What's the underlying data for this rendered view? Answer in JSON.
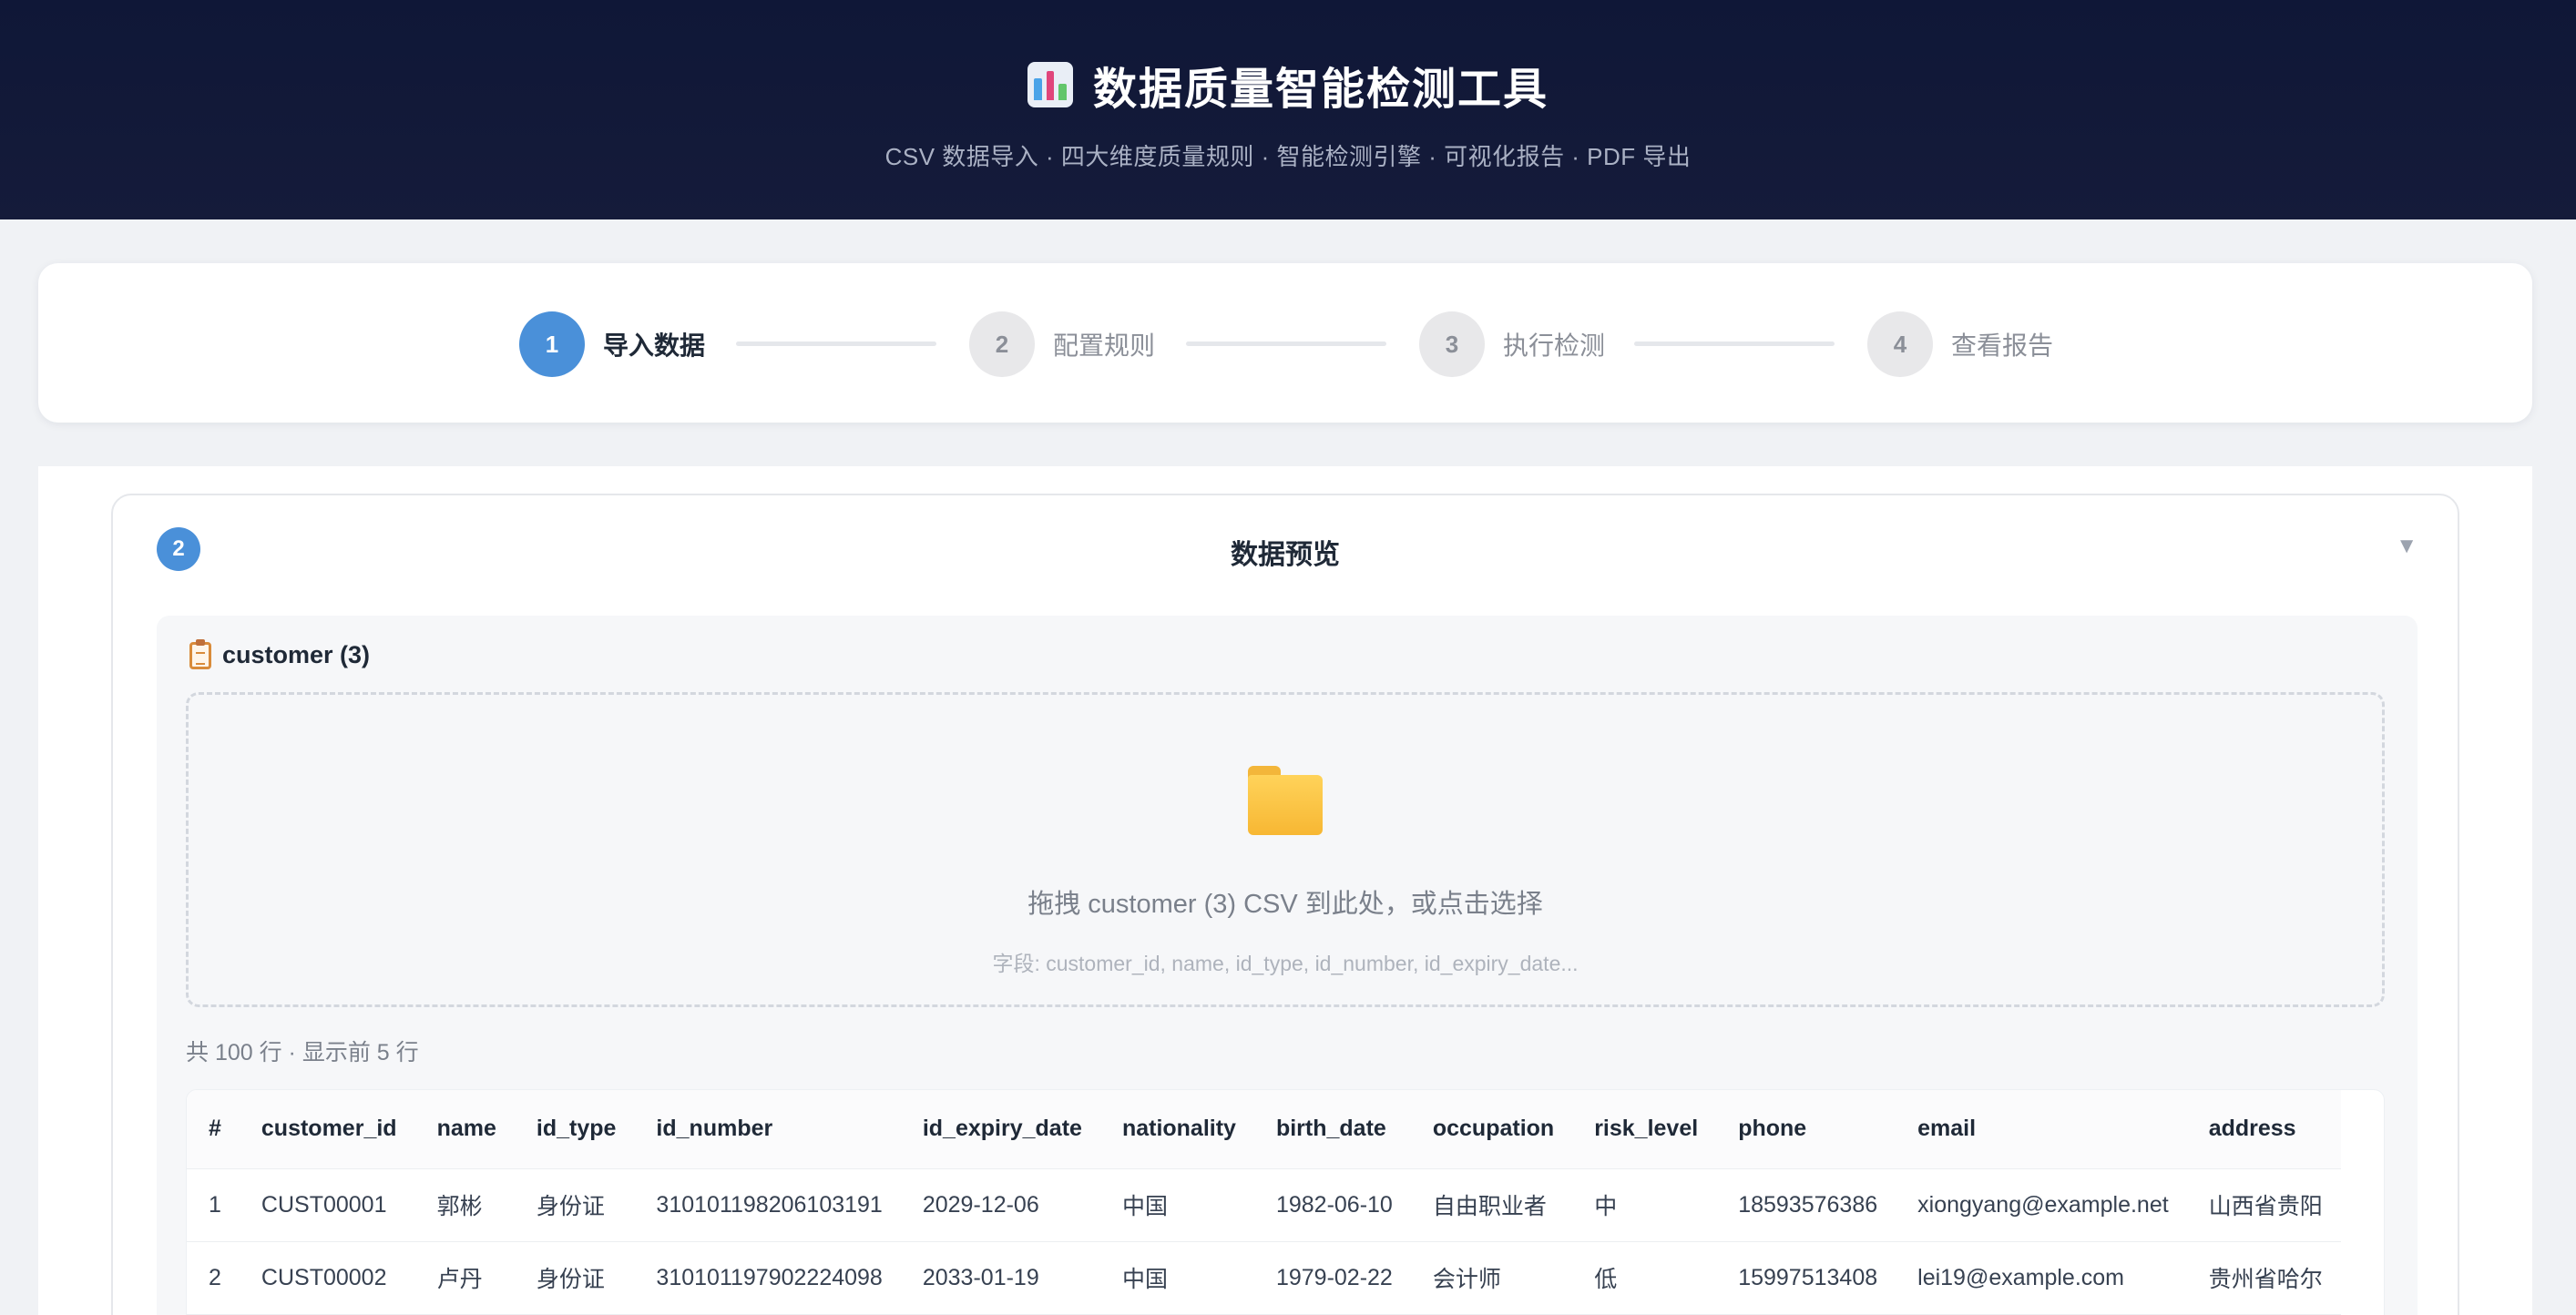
{
  "header": {
    "title": "数据质量智能检测工具",
    "subtitle": "CSV 数据导入 · 四大维度质量规则 · 智能检测引擎 · 可视化报告 · PDF 导出",
    "icon": "bar-chart-icon"
  },
  "steps": [
    {
      "number": "1",
      "label": "导入数据",
      "active": true
    },
    {
      "number": "2",
      "label": "配置规则",
      "active": false
    },
    {
      "number": "3",
      "label": "执行检测",
      "active": false
    },
    {
      "number": "4",
      "label": "查看报告",
      "active": false
    }
  ],
  "section": {
    "badge": "2",
    "title": "数据预览",
    "toggle": "▼"
  },
  "dataset": {
    "name": "customer (3)",
    "drop_text": "拖拽 customer (3) CSV 到此处，或点击选择",
    "drop_fields": "字段: customer_id, name, id_type, id_number, id_expiry_date...",
    "row_count": "共 100 行 · 显示前 5 行"
  },
  "table": {
    "columns": [
      "#",
      "customer_id",
      "name",
      "id_type",
      "id_number",
      "id_expiry_date",
      "nationality",
      "birth_date",
      "occupation",
      "risk_level",
      "phone",
      "email",
      "address"
    ],
    "rows": [
      [
        "1",
        "CUST00001",
        "郭彬",
        "身份证",
        "310101198206103191",
        "2029-12-06",
        "中国",
        "1982-06-10",
        "自由职业者",
        "中",
        "18593576386",
        "xiongyang@example.net",
        "山西省贵阳"
      ],
      [
        "2",
        "CUST00002",
        "卢丹",
        "身份证",
        "310101197902224098",
        "2033-01-19",
        "中国",
        "1979-02-22",
        "会计师",
        "低",
        "15997513408",
        "lei19@example.com",
        "贵州省哈尔"
      ]
    ]
  },
  "colors": {
    "header_bg": "#0f1737",
    "accent": "#4a90d9",
    "folder": "#f7b733"
  }
}
